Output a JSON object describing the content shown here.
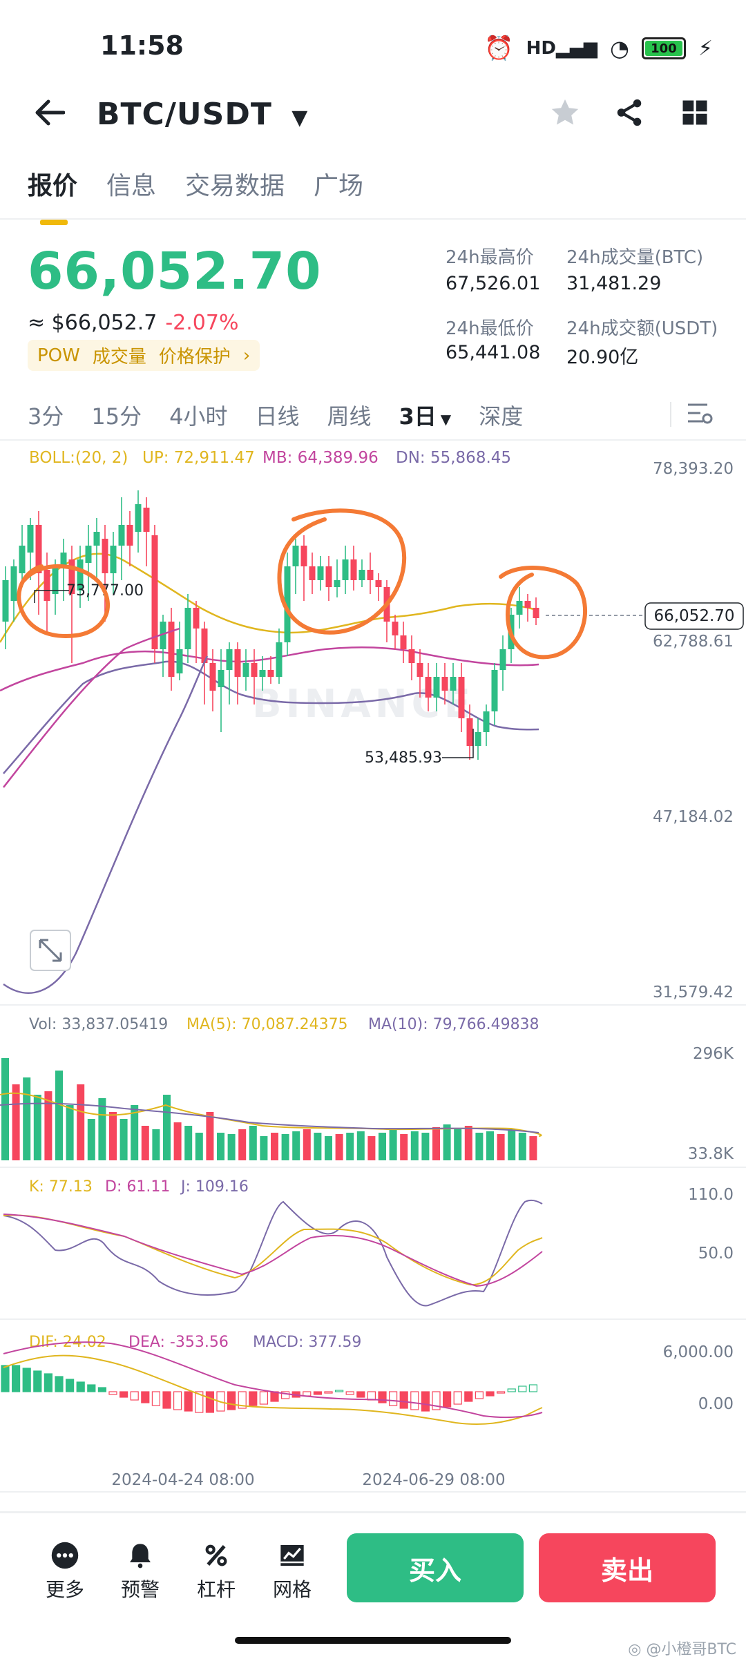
{
  "status": {
    "time": "11:58",
    "battery": "100",
    "network": "HD"
  },
  "header": {
    "pair": "BTC/USDT"
  },
  "tabs": [
    "报价",
    "信息",
    "交易数据",
    "广场"
  ],
  "ticker": {
    "last_price": "66,052.70",
    "fiat": "≈ $66,052.7",
    "change": "-2.07%",
    "tags": [
      "POW",
      "成交量",
      "价格保护"
    ],
    "high_label": "24h最高价",
    "high": "67,526.01",
    "low_label": "24h最低价",
    "low": "65,441.08",
    "vol_btc_label": "24h成交量(BTC)",
    "vol_btc": "31,481.29",
    "vol_usdt_label": "24h成交额(USDT)",
    "vol_usdt": "20.90亿"
  },
  "intervals": [
    "3分",
    "15分",
    "4小时",
    "日线",
    "周线",
    "3日",
    "深度"
  ],
  "chart": {
    "boll": {
      "label": "BOLL:(20, 2)",
      "up": "UP: 72,911.47",
      "mb": "MB: 64,389.96",
      "dn": "DN: 55,868.45"
    },
    "price_axis": [
      "78,393.20",
      "62,788.61",
      "47,184.02",
      "31,579.42"
    ],
    "current_price_tag": "66,052.70",
    "high_marker": "73,777.00",
    "low_marker": "53,485.93",
    "watermark": "BINANCE",
    "vol": {
      "vol": "Vol: 33,837.05419",
      "ma5": "MA(5): 70,087.24375",
      "ma10": "MA(10): 79,766.49838",
      "axis_top": "296K",
      "axis_bottom": "33.8K"
    },
    "kdj": {
      "k": "K: 77.13",
      "d": "D: 61.11",
      "j": "J: 109.16",
      "axis_top": "110.0",
      "axis_mid": "50.0"
    },
    "macd": {
      "dif": "DIF: 24.02",
      "dea": "DEA: -353.56",
      "macd": "MACD: 377.59",
      "axis_top": "6,000.00",
      "axis_zero": "0.00"
    },
    "dates": [
      "2024-04-24 08:00",
      "2024-06-29 08:00"
    ]
  },
  "bottom_nav": {
    "more": "更多",
    "alert": "预警",
    "leverage": "杠杆",
    "grid": "网格",
    "buy": "买入",
    "sell": "卖出"
  },
  "watermark": "小橙哥BTC",
  "colors": {
    "up": "#2ebd85",
    "down": "#f6465d",
    "accent": "#f0b90b",
    "annotation": "#f47a35",
    "boll_up": "#e0b61f",
    "boll_mb": "#c2459e",
    "boll_dn": "#7a6aa8"
  }
}
